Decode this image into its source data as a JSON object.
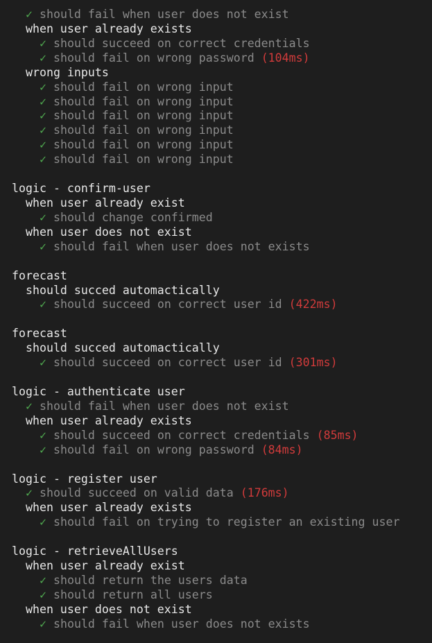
{
  "colors": {
    "background": "#1e1e1e",
    "pass_check": "#4fa84f",
    "passed_test_text": "#8b8b8b",
    "suite_text": "#e8e8e8",
    "slow_duration": "#d23b3b"
  },
  "check_glyph": "✓",
  "lines": [
    {
      "indent": 1,
      "kind": "test",
      "text": "should fail when user does not exist",
      "duration": ""
    },
    {
      "indent": 1,
      "kind": "suite",
      "text": "when user already exists"
    },
    {
      "indent": 2,
      "kind": "test",
      "text": "should succeed on correct credentials",
      "duration": ""
    },
    {
      "indent": 2,
      "kind": "test",
      "text": "should fail on wrong password",
      "duration": "(104ms)"
    },
    {
      "indent": 1,
      "kind": "suite",
      "text": "wrong inputs"
    },
    {
      "indent": 2,
      "kind": "test",
      "text": "should fail on wrong input",
      "duration": ""
    },
    {
      "indent": 2,
      "kind": "test",
      "text": "should fail on wrong input",
      "duration": ""
    },
    {
      "indent": 2,
      "kind": "test",
      "text": "should fail on wrong input",
      "duration": ""
    },
    {
      "indent": 2,
      "kind": "test",
      "text": "should fail on wrong input",
      "duration": ""
    },
    {
      "indent": 2,
      "kind": "test",
      "text": "should fail on wrong input",
      "duration": ""
    },
    {
      "indent": 2,
      "kind": "test",
      "text": "should fail on wrong input",
      "duration": ""
    },
    {
      "indent": 0,
      "kind": "blank",
      "text": ""
    },
    {
      "indent": 0,
      "kind": "suite",
      "text": "logic - confirm-user"
    },
    {
      "indent": 1,
      "kind": "suite",
      "text": "when user already exist"
    },
    {
      "indent": 2,
      "kind": "test",
      "text": "should change confirmed",
      "duration": ""
    },
    {
      "indent": 1,
      "kind": "suite",
      "text": "when user does not exist"
    },
    {
      "indent": 2,
      "kind": "test",
      "text": "should fail when user does not exists",
      "duration": ""
    },
    {
      "indent": 0,
      "kind": "blank",
      "text": ""
    },
    {
      "indent": 0,
      "kind": "suite",
      "text": "forecast"
    },
    {
      "indent": 1,
      "kind": "suite",
      "text": "should succed automactically"
    },
    {
      "indent": 2,
      "kind": "test",
      "text": "should succeed on correct user id",
      "duration": "(422ms)"
    },
    {
      "indent": 0,
      "kind": "blank",
      "text": ""
    },
    {
      "indent": 0,
      "kind": "suite",
      "text": "forecast"
    },
    {
      "indent": 1,
      "kind": "suite",
      "text": "should succed automactically"
    },
    {
      "indent": 2,
      "kind": "test",
      "text": "should succeed on correct user id",
      "duration": "(301ms)"
    },
    {
      "indent": 0,
      "kind": "blank",
      "text": ""
    },
    {
      "indent": 0,
      "kind": "suite",
      "text": "logic - authenticate user"
    },
    {
      "indent": 1,
      "kind": "test",
      "text": "should fail when user does not exist",
      "duration": ""
    },
    {
      "indent": 1,
      "kind": "suite",
      "text": "when user already exists"
    },
    {
      "indent": 2,
      "kind": "test",
      "text": "should succeed on correct credentials",
      "duration": "(85ms)"
    },
    {
      "indent": 2,
      "kind": "test",
      "text": "should fail on wrong password",
      "duration": "(84ms)"
    },
    {
      "indent": 0,
      "kind": "blank",
      "text": ""
    },
    {
      "indent": 0,
      "kind": "suite",
      "text": "logic - register user"
    },
    {
      "indent": 1,
      "kind": "test",
      "text": "should succeed on valid data",
      "duration": "(176ms)"
    },
    {
      "indent": 1,
      "kind": "suite",
      "text": "when user already exists"
    },
    {
      "indent": 2,
      "kind": "test",
      "text": "should fail on trying to register an existing user",
      "duration": ""
    },
    {
      "indent": 0,
      "kind": "blank",
      "text": ""
    },
    {
      "indent": 0,
      "kind": "suite",
      "text": "logic - retrieveAllUsers"
    },
    {
      "indent": 1,
      "kind": "suite",
      "text": "when user already exist"
    },
    {
      "indent": 2,
      "kind": "test",
      "text": "should return the users data",
      "duration": ""
    },
    {
      "indent": 2,
      "kind": "test",
      "text": "should return all users",
      "duration": ""
    },
    {
      "indent": 1,
      "kind": "suite",
      "text": "when user does not exist"
    },
    {
      "indent": 2,
      "kind": "test",
      "text": "should fail when user does not exists",
      "duration": ""
    }
  ]
}
